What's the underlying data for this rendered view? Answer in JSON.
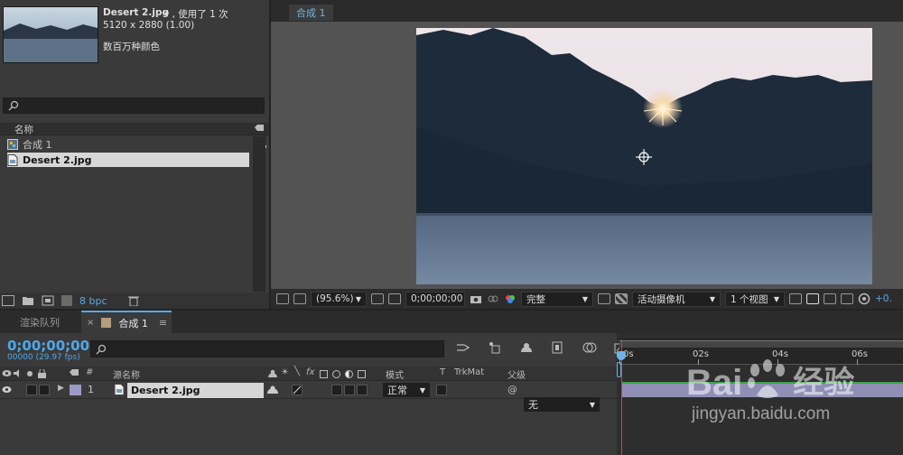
{
  "project": {
    "file_name": "Desert 2.jpg",
    "usage": "▾ , 使用了 1 次",
    "dimensions": "5120 x 2880 (1.00)",
    "color_depth_desc": "数百万种颜色",
    "column_name": "名称",
    "items": [
      {
        "label": "合成 1",
        "selected": false
      },
      {
        "label": "Desert 2.jpg",
        "selected": true
      }
    ],
    "bpc": "8 bpc"
  },
  "viewer": {
    "tab_label": "合成 1",
    "toolbar": {
      "zoom": "(95.6%)",
      "timecode": "0;00;00;00",
      "resolution": "完整",
      "camera": "活动摄像机",
      "views": "1 个视图",
      "exposure": "+0."
    }
  },
  "timeline": {
    "render_queue_tab": "渲染队列",
    "comp_tab": "合成 1",
    "timecode": "0;00;00;00",
    "fps": "00000 (29.97 fps)",
    "headers": {
      "num": "#",
      "source_name": "源名称",
      "fx": "fx",
      "mode": "模式",
      "t": "T",
      "trkmat": "TrkMat",
      "parent": "父级"
    },
    "layer": {
      "index": "1",
      "name": "Desert 2.jpg",
      "mode": "正常",
      "parent": "无"
    },
    "ruler_ticks": [
      "0s",
      "02s",
      "04s",
      "06s"
    ]
  },
  "watermark": {
    "brand": "Bai",
    "brand2": "经验",
    "url": "jingyan.baidu.com"
  },
  "colors": {
    "accent": "#5aa9e6",
    "playhead": "#e23b3b",
    "layer_bar": "#8f8fb6"
  }
}
